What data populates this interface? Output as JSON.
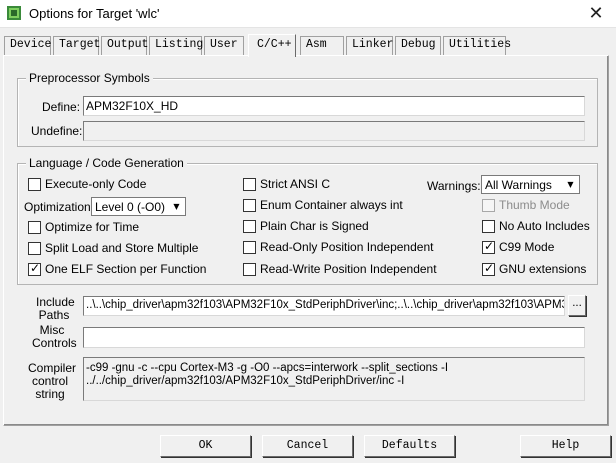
{
  "window": {
    "title": "Options for Target 'wlc'",
    "close_glyph": "✕"
  },
  "tabs": [
    {
      "label": "Device",
      "active": false
    },
    {
      "label": "Target",
      "active": false
    },
    {
      "label": "Output",
      "active": false
    },
    {
      "label": "Listing",
      "active": false
    },
    {
      "label": "User",
      "active": false
    },
    {
      "label": "C/C++",
      "active": true
    },
    {
      "label": "Asm",
      "active": false
    },
    {
      "label": "Linker",
      "active": false
    },
    {
      "label": "Debug",
      "active": false
    },
    {
      "label": "Utilities",
      "active": false
    }
  ],
  "preprocessor": {
    "legend": "Preprocessor Symbols",
    "define_label": "Define:",
    "define_value": "APM32F10X_HD",
    "undefine_label": "Undefine:",
    "undefine_value": ""
  },
  "codegen": {
    "legend": "Language / Code Generation",
    "execute_only": {
      "label": "Execute-only Code",
      "checked": false
    },
    "optimization_label": "Optimization:",
    "optimization_value": "Level 0 (-O0)",
    "optimize_time": {
      "label": "Optimize for Time",
      "checked": false
    },
    "split_load": {
      "label": "Split Load and Store Multiple",
      "checked": false
    },
    "one_elf": {
      "label": "One ELF Section per Function",
      "checked": true
    },
    "strict_ansi": {
      "label": "Strict ANSI C",
      "checked": false
    },
    "enum_int": {
      "label": "Enum Container always int",
      "checked": false
    },
    "plain_char": {
      "label": "Plain Char is Signed",
      "checked": false
    },
    "ro_pi": {
      "label": "Read-Only Position Independent",
      "checked": false
    },
    "rw_pi": {
      "label": "Read-Write Position Independent",
      "checked": false
    },
    "warnings_label": "Warnings:",
    "warnings_value": "All Warnings",
    "thumb_mode": {
      "label": "Thumb Mode",
      "checked": false,
      "disabled": true
    },
    "no_auto_includes": {
      "label": "No Auto Includes",
      "checked": false
    },
    "c99_mode": {
      "label": "C99 Mode",
      "checked": true
    },
    "gnu_ext": {
      "label": "GNU extensions",
      "checked": true
    }
  },
  "include_paths": {
    "label_line1": "Include",
    "label_line2": "Paths",
    "value": "..\\..\\chip_driver\\apm32f103\\APM32F10x_StdPeriphDriver\\inc;..\\..\\chip_driver\\apm32f103\\APM32F",
    "browse_label": "..."
  },
  "misc_controls": {
    "label_line1": "Misc",
    "label_line2": "Controls",
    "value": ""
  },
  "compiler_string": {
    "label_line1": "Compiler",
    "label_line2": "control",
    "label_line3": "string",
    "line1": "-c99 -gnu -c --cpu Cortex-M3 -g -O0 --apcs=interwork --split_sections -I",
    "line2": "../../chip_driver/apm32f103/APM32F10x_StdPeriphDriver/inc -I"
  },
  "buttons": {
    "ok": "OK",
    "cancel": "Cancel",
    "defaults": "Defaults",
    "help": "Help"
  },
  "icons": {
    "app": "keil-uvision-app-icon",
    "close": "close-icon",
    "dropdown": "chevron-down-icon",
    "check": "check-icon"
  }
}
